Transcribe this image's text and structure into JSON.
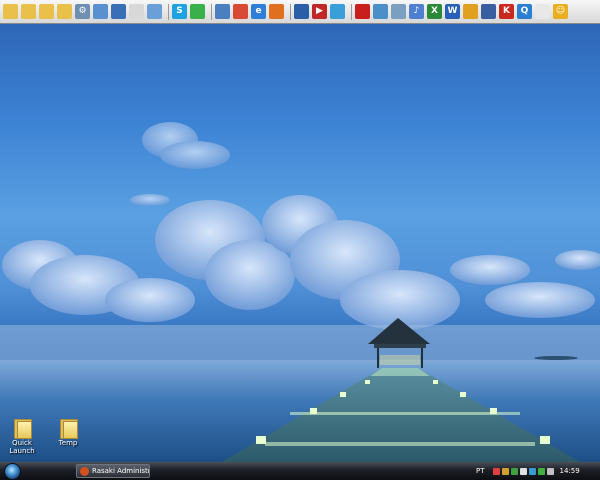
{
  "toolbar": {
    "icons": [
      {
        "name": "folder-icon",
        "glyph": "",
        "color": "#e8c04a"
      },
      {
        "name": "folder-icon",
        "glyph": "",
        "color": "#e8c04a"
      },
      {
        "name": "folder-icon",
        "glyph": "",
        "color": "#e8c04a"
      },
      {
        "name": "folder-icon",
        "glyph": "",
        "color": "#e8c04a"
      },
      {
        "name": "settings-icon",
        "glyph": "⚙",
        "color": "#6f8fb0"
      },
      {
        "name": "network-icon",
        "glyph": "",
        "color": "#5a8fd0"
      },
      {
        "name": "computer-icon",
        "glyph": "",
        "color": "#3a6fb8"
      },
      {
        "name": "document-icon",
        "glyph": "",
        "color": "#d8d8d8"
      },
      {
        "name": "window-icon",
        "glyph": "",
        "color": "#6a9fd8"
      },
      {
        "sep": true
      },
      {
        "name": "skype-icon",
        "glyph": "S",
        "color": "#1fa3e0"
      },
      {
        "name": "messenger-icon",
        "glyph": "",
        "color": "#3ab04a"
      },
      {
        "sep": true
      },
      {
        "name": "browser-icon",
        "glyph": "",
        "color": "#4a7fc0"
      },
      {
        "name": "chrome-icon",
        "glyph": "",
        "color": "#d84a36"
      },
      {
        "name": "internet-explorer-icon",
        "glyph": "e",
        "color": "#2f7fd8"
      },
      {
        "name": "firefox-icon",
        "glyph": "",
        "color": "#e07020"
      },
      {
        "sep": true
      },
      {
        "name": "desktop-icon",
        "glyph": "",
        "color": "#2a5fa8"
      },
      {
        "name": "media-player-icon",
        "glyph": "▶",
        "color": "#c02828"
      },
      {
        "name": "image-icon",
        "glyph": "",
        "color": "#3a9fd8"
      },
      {
        "sep": true
      },
      {
        "name": "pdf-icon",
        "glyph": "",
        "color": "#c81e1e"
      },
      {
        "name": "network-drive-icon",
        "glyph": "",
        "color": "#4a8fc8"
      },
      {
        "name": "edit-icon",
        "glyph": "",
        "color": "#7a9fc0"
      },
      {
        "name": "music-icon",
        "glyph": "♪",
        "color": "#4f7fd0"
      },
      {
        "name": "excel-icon",
        "glyph": "X",
        "color": "#2a8a3a"
      },
      {
        "name": "word-icon",
        "glyph": "W",
        "color": "#2a5fb8"
      },
      {
        "name": "video-icon",
        "glyph": "",
        "color": "#e0a020"
      },
      {
        "name": "monitor-icon",
        "glyph": "",
        "color": "#3a5fa0"
      },
      {
        "name": "antivirus-icon",
        "glyph": "K",
        "color": "#c8281e"
      },
      {
        "name": "search-icon",
        "glyph": "Q",
        "color": "#2a7fd0"
      },
      {
        "name": "notepad-icon",
        "glyph": "",
        "color": "#e8e8e8"
      },
      {
        "name": "smiley-icon",
        "glyph": "☺",
        "color": "#e8b020"
      }
    ]
  },
  "desktop": {
    "icons": [
      {
        "label": "Quick Launch"
      },
      {
        "label": "Temp"
      }
    ]
  },
  "taskbar": {
    "window_label": "Rasaki Administrac...",
    "language": "PT",
    "clock": "14:59",
    "tray_colors": [
      "#e04040",
      "#d0a030",
      "#40a040",
      "#e0e0e0",
      "#3a9ad0",
      "#40b040",
      "#c0c0c0"
    ]
  },
  "colors": {
    "taskbar": "#1c1f26",
    "toolbar": "#e6e6e6",
    "sky": "#3c82d4"
  }
}
